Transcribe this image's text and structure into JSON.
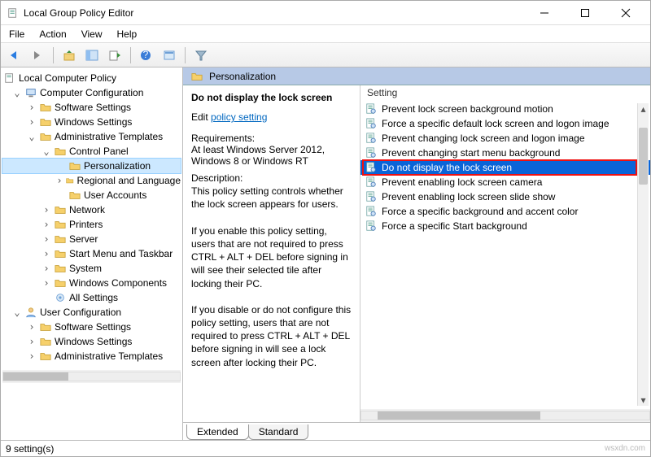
{
  "titlebar": {
    "title": "Local Group Policy Editor"
  },
  "menubar": [
    "File",
    "Action",
    "View",
    "Help"
  ],
  "tree_root": "Local Computer Policy",
  "tree": {
    "cc": "Computer Configuration",
    "cc_children": {
      "ss": "Software Settings",
      "ws": "Windows Settings",
      "at": "Administrative Templates",
      "at_children": {
        "cp": "Control Panel",
        "cp_children": {
          "pers": "Personalization",
          "rl": "Regional and Language",
          "ua": "User Accounts"
        },
        "net": "Network",
        "prn": "Printers",
        "srv": "Server",
        "smt": "Start Menu and Taskbar",
        "sys": "System",
        "wc": "Windows Components",
        "all": "All Settings"
      }
    },
    "uc": "User Configuration",
    "uc_children": {
      "ss": "Software Settings",
      "ws": "Windows Settings",
      "at": "Administrative Templates"
    }
  },
  "header": {
    "name": "Personalization"
  },
  "detail": {
    "title": "Do not display the lock screen",
    "edit_prefix": "Edit ",
    "edit_link": "policy setting",
    "req_label": "Requirements:",
    "req_text": "At least Windows Server 2012, Windows 8 or Windows RT",
    "desc_label": "Description:",
    "desc_text": "This policy setting controls whether the lock screen appears for users.\n\nIf you enable this policy setting, users that are not required to press CTRL + ALT + DEL before signing in will see their selected tile after locking their PC.\n\nIf you disable or do not configure this policy setting, users that are not required to press CTRL + ALT + DEL before signing in will see a lock screen after locking their PC."
  },
  "list": {
    "header": "Setting",
    "items": [
      "Prevent lock screen background motion",
      "Force a specific default lock screen and logon image",
      "Prevent changing lock screen and logon image",
      "Prevent changing start menu background",
      "Do not display the lock screen",
      "Prevent enabling lock screen camera",
      "Prevent enabling lock screen slide show",
      "Force a specific background and accent color",
      "Force a specific Start background"
    ],
    "selected_index": 4
  },
  "tabs": {
    "extended": "Extended",
    "standard": "Standard"
  },
  "status": {
    "count": "9 setting(s)"
  },
  "watermark": "wsxdn.com"
}
